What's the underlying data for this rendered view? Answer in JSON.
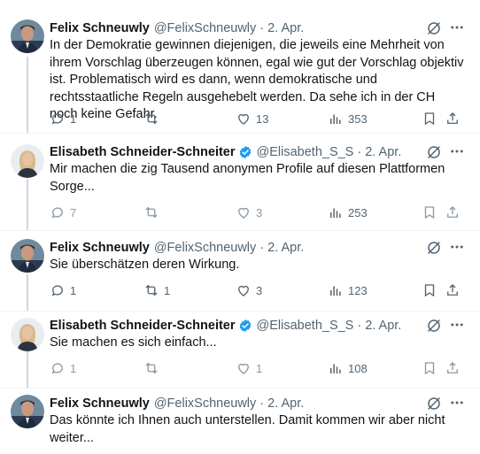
{
  "tweets": [
    {
      "author": "Felix Schneuwly",
      "handle": "@FelixSchneuwly",
      "separator": "·",
      "date": "2. Apr.",
      "verified": false,
      "text": "In der Demokratie gewinnen diejenigen, die jeweils eine Mehrheit von ihrem Vorschlag überzeugen können, egal wie gut der Vorschlag objektiv ist. Problematisch wird es dann, wenn demokratische und rechtsstaatliche Regeln ausgehebelt werden. Da sehe ich in der CH noch keine Gefahr.",
      "replies": "1",
      "reposts": "",
      "likes": "13",
      "views": "353"
    },
    {
      "author": "Elisabeth Schneider-Schneiter",
      "handle": "@Elisabeth_S_S",
      "separator": "·",
      "date": "2. Apr.",
      "verified": true,
      "text": "Mir machen die zig Tausend anonymen Profile auf diesen Plattformen Sorge...",
      "replies": "7",
      "reposts": "",
      "likes": "3",
      "views": "253"
    },
    {
      "author": "Felix Schneuwly",
      "handle": "@FelixSchneuwly",
      "separator": "·",
      "date": "2. Apr.",
      "verified": false,
      "text": "Sie überschätzen deren Wirkung.",
      "replies": "1",
      "reposts": "1",
      "likes": "3",
      "views": "123"
    },
    {
      "author": "Elisabeth Schneider-Schneiter",
      "handle": "@Elisabeth_S_S",
      "separator": "·",
      "date": "2. Apr.",
      "verified": true,
      "text": "Sie machen es sich einfach...",
      "replies": "1",
      "reposts": "",
      "likes": "1",
      "views": "108"
    },
    {
      "author": "Felix Schneuwly",
      "handle": "@FelixSchneuwly",
      "separator": "·",
      "date": "2. Apr.",
      "verified": false,
      "text": "Das könnte ich Ihnen auch unterstellen. Damit kommen wir aber nicht weiter...",
      "replies": "",
      "reposts": "",
      "likes": "",
      "views": ""
    }
  ],
  "icons": {
    "reply": "reply-icon",
    "repost": "repost-icon",
    "like": "like-icon",
    "views": "views-icon",
    "bookmark": "bookmark-icon",
    "share": "share-icon",
    "grok": "grok-icon",
    "more": "more-icon",
    "verified": "verified-badge-icon"
  },
  "colors": {
    "text": "#0f1419",
    "secondary": "#536471",
    "verified": "#1d9bf0",
    "thread_line": "#cfd9de",
    "divider": "#eff3f4"
  }
}
